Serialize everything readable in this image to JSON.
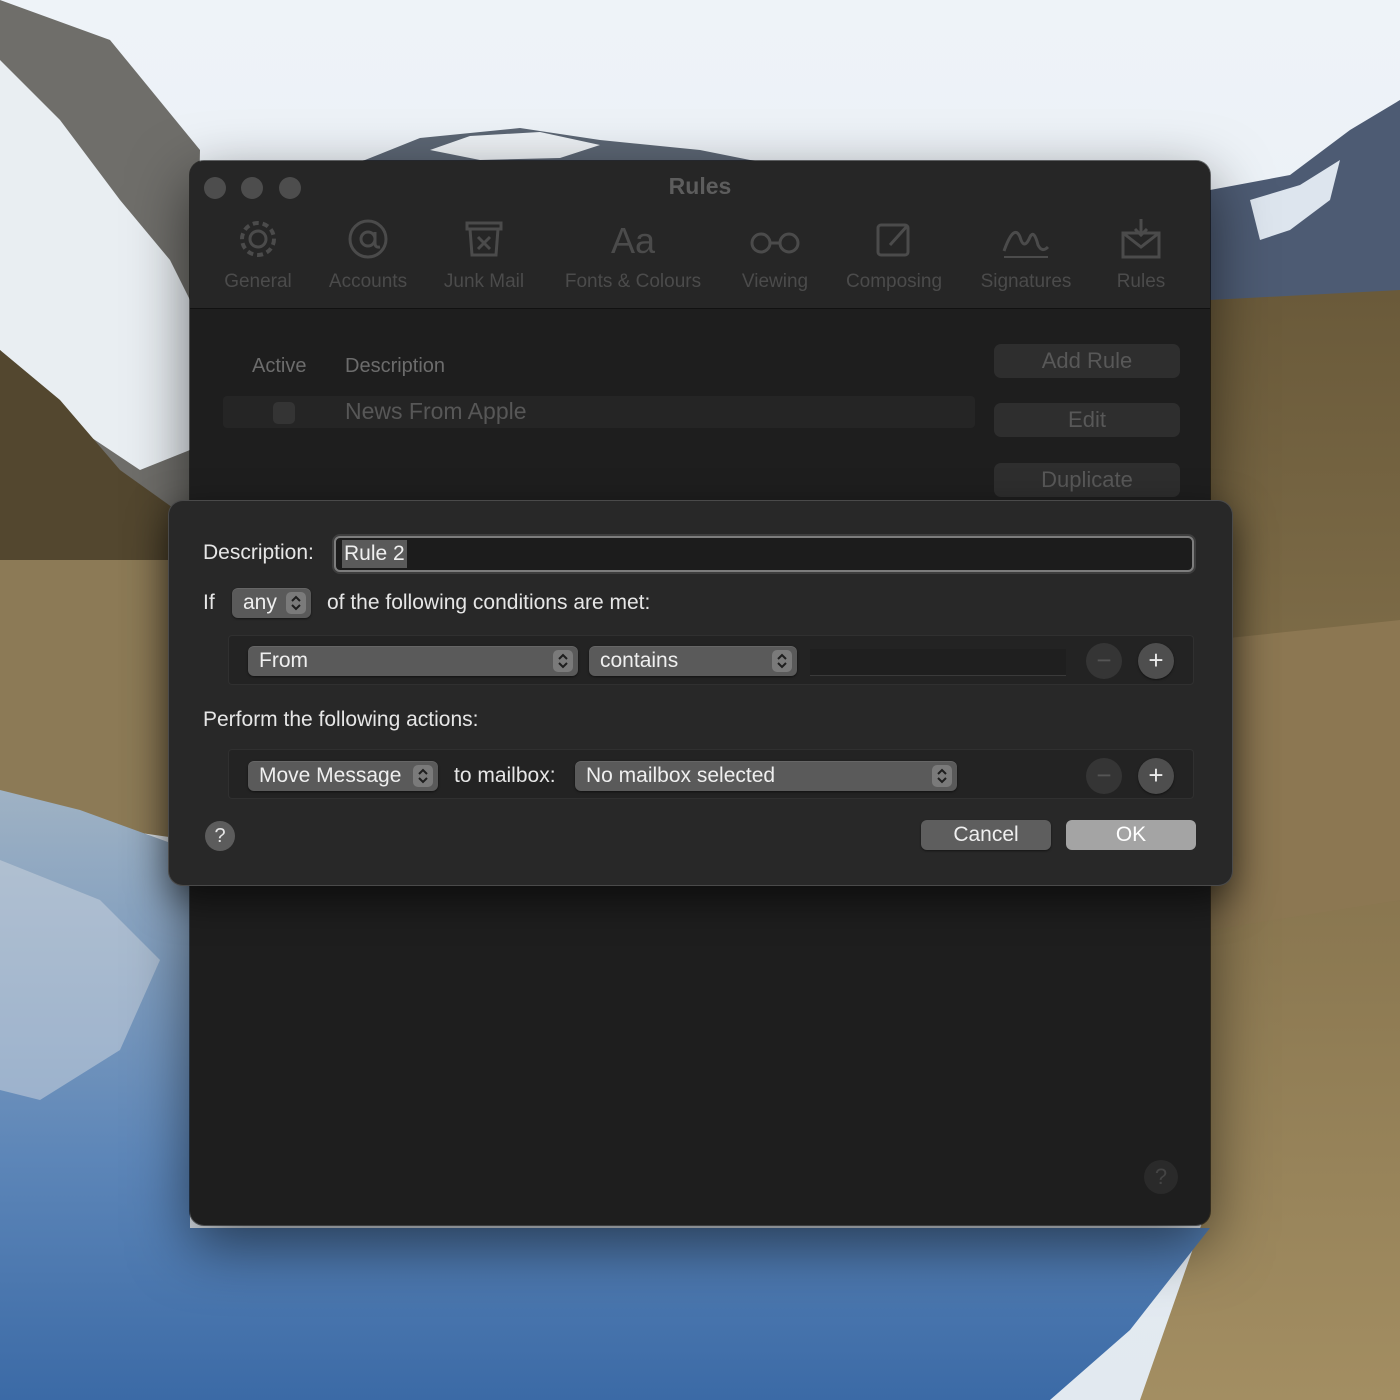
{
  "window": {
    "title": "Rules",
    "toolbar": [
      {
        "label": "General",
        "icon": "gear-icon"
      },
      {
        "label": "Accounts",
        "icon": "at-sign-icon"
      },
      {
        "label": "Junk Mail",
        "icon": "junk-mail-icon"
      },
      {
        "label": "Fonts & Colours",
        "icon": "fonts-icon"
      },
      {
        "label": "Viewing",
        "icon": "glasses-icon"
      },
      {
        "label": "Composing",
        "icon": "compose-icon"
      },
      {
        "label": "Signatures",
        "icon": "signature-icon"
      },
      {
        "label": "Rules",
        "icon": "rules-envelope-icon"
      }
    ],
    "columns": {
      "active": "Active",
      "description": "Description"
    },
    "rules": [
      {
        "description": "News From Apple",
        "active": false
      }
    ],
    "buttons": {
      "add_rule": "Add Rule",
      "edit": "Edit",
      "duplicate": "Duplicate"
    },
    "help": "?"
  },
  "sheet": {
    "description_label": "Description:",
    "description_value": "Rule 2",
    "if_label": "If",
    "match_selector": "any",
    "conditions_label": "of the following conditions are met:",
    "condition": {
      "field": "From",
      "operator": "contains",
      "value": ""
    },
    "actions_label": "Perform the following actions:",
    "action": {
      "type": "Move Message",
      "to_label": "to mailbox:",
      "mailbox": "No mailbox selected"
    },
    "minus": "−",
    "plus": "+",
    "help": "?",
    "cancel": "Cancel",
    "ok": "OK"
  }
}
